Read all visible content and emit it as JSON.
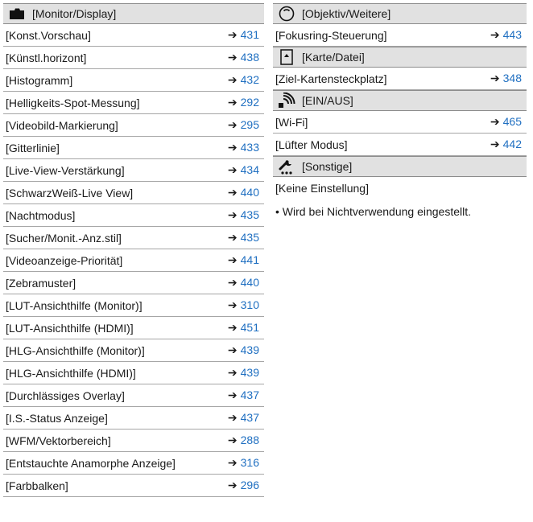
{
  "left": {
    "section": {
      "label": "[Monitor/Display]",
      "icon": "camera-icon"
    },
    "items": [
      {
        "name": "[Konst.Vorschau]",
        "page": "431"
      },
      {
        "name": "[Künstl.horizont]",
        "page": "438"
      },
      {
        "name": "[Histogramm]",
        "page": "432"
      },
      {
        "name": "[Helligkeits-Spot-Messung]",
        "page": "292"
      },
      {
        "name": "[Videobild-Markierung]",
        "page": "295"
      },
      {
        "name": "[Gitterlinie]",
        "page": "433"
      },
      {
        "name": "[Live-View-Verstärkung]",
        "page": "434"
      },
      {
        "name": "[SchwarzWeiß-Live View]",
        "page": "440"
      },
      {
        "name": "[Nachtmodus]",
        "page": "435"
      },
      {
        "name": "[Sucher/Monit.-Anz.stil]",
        "page": "435"
      },
      {
        "name": "[Videoanzeige-Priorität]",
        "page": "441"
      },
      {
        "name": "[Zebramuster]",
        "page": "440"
      },
      {
        "name": "[LUT-Ansichthilfe (Monitor)]",
        "page": "310"
      },
      {
        "name": "[LUT-Ansichthilfe (HDMI)]",
        "page": "451"
      },
      {
        "name": "[HLG-Ansichthilfe (Monitor)]",
        "page": "439"
      },
      {
        "name": "[HLG-Ansichthilfe (HDMI)]",
        "page": "439"
      },
      {
        "name": "[Durchlässiges Overlay]",
        "page": "437"
      },
      {
        "name": "[I.S.-Status Anzeige]",
        "page": "437"
      },
      {
        "name": "[WFM/Vektorbereich]",
        "page": "288"
      },
      {
        "name": "[Entstauchte Anamorphe Anzeige]",
        "page": "316"
      },
      {
        "name": "[Farbbalken]",
        "page": "296"
      }
    ]
  },
  "right": {
    "sections": [
      {
        "label": "[Objektiv/Weitere]",
        "icon": "lens-icon",
        "items": [
          {
            "name": "[Fokusring-Steuerung]",
            "page": "443"
          }
        ]
      },
      {
        "label": "[Karte/Datei]",
        "icon": "card-icon",
        "items": [
          {
            "name": "[Ziel-Kartensteckplatz]",
            "page": "348"
          }
        ]
      },
      {
        "label": "[EIN/AUS]",
        "icon": "wireless-icon",
        "items": [
          {
            "name": "[Wi-Fi]",
            "page": "465"
          },
          {
            "name": "[Lüfter Modus]",
            "page": "442"
          }
        ]
      },
      {
        "label": "[Sonstige]",
        "icon": "wrench-icon",
        "items": [
          {
            "name": "[Keine Einstellung]",
            "page": ""
          }
        ]
      }
    ],
    "note": "• Wird bei Nichtverwendung eingestellt."
  },
  "arrow": "➔",
  "colors": {
    "link": "#1f6fc1",
    "header_bg": "#e1e1e1"
  }
}
